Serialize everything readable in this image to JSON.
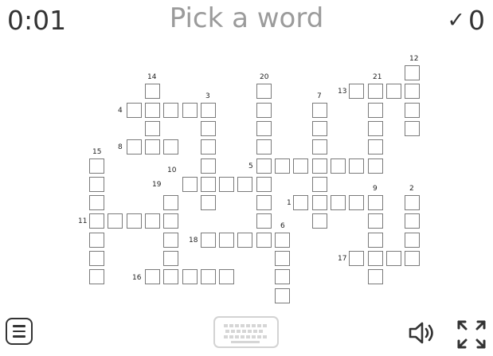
{
  "header": {
    "timer": "0:01",
    "prompt": "Pick a word",
    "score": "0",
    "check_icon": "✓"
  },
  "clue_numbers": [
    "14",
    "3",
    "20",
    "12",
    "7",
    "13",
    "21",
    "4",
    "15",
    "8",
    "10",
    "5",
    "19",
    "9",
    "2",
    "1",
    "11",
    "6",
    "18",
    "17",
    "16"
  ],
  "colors": {
    "text": "#333333",
    "prompt": "#9b9b9b",
    "cell_border": "#7a7a7a",
    "keyboard_border": "#d3d3d3"
  },
  "icons": {
    "menu": "menu-icon",
    "keyboard": "keyboard-icon",
    "sound": "speaker-icon",
    "fullscreen": "fullscreen-icon"
  }
}
